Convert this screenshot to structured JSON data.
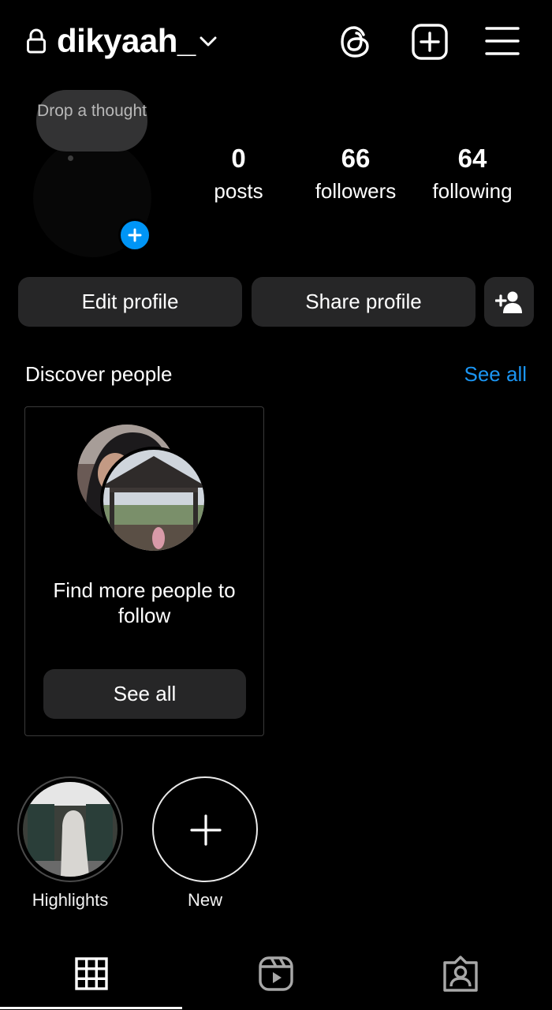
{
  "header": {
    "username": "dikyaah_",
    "icons": [
      "lock-icon",
      "chevron-down-icon",
      "threads-icon",
      "create-post-icon",
      "menu-icon"
    ]
  },
  "profile": {
    "note_placeholder": "Drop a thought",
    "stats": {
      "posts": {
        "value": "0",
        "label": "posts"
      },
      "followers": {
        "value": "66",
        "label": "followers"
      },
      "following": {
        "value": "64",
        "label": "following"
      }
    },
    "buttons": {
      "edit": "Edit profile",
      "share": "Share profile"
    }
  },
  "discover": {
    "title": "Discover people",
    "see_all": "See all",
    "card": {
      "text": "Find more people to follow",
      "button": "See all"
    }
  },
  "highlights": [
    {
      "label": "Highlights"
    },
    {
      "label": "New"
    }
  ],
  "tabs": [
    "grid-icon",
    "reels-icon",
    "tagged-icon"
  ],
  "colors": {
    "background": "#000000",
    "button": "#262627",
    "accent": "#0095f6",
    "link": "#1b95f2"
  }
}
